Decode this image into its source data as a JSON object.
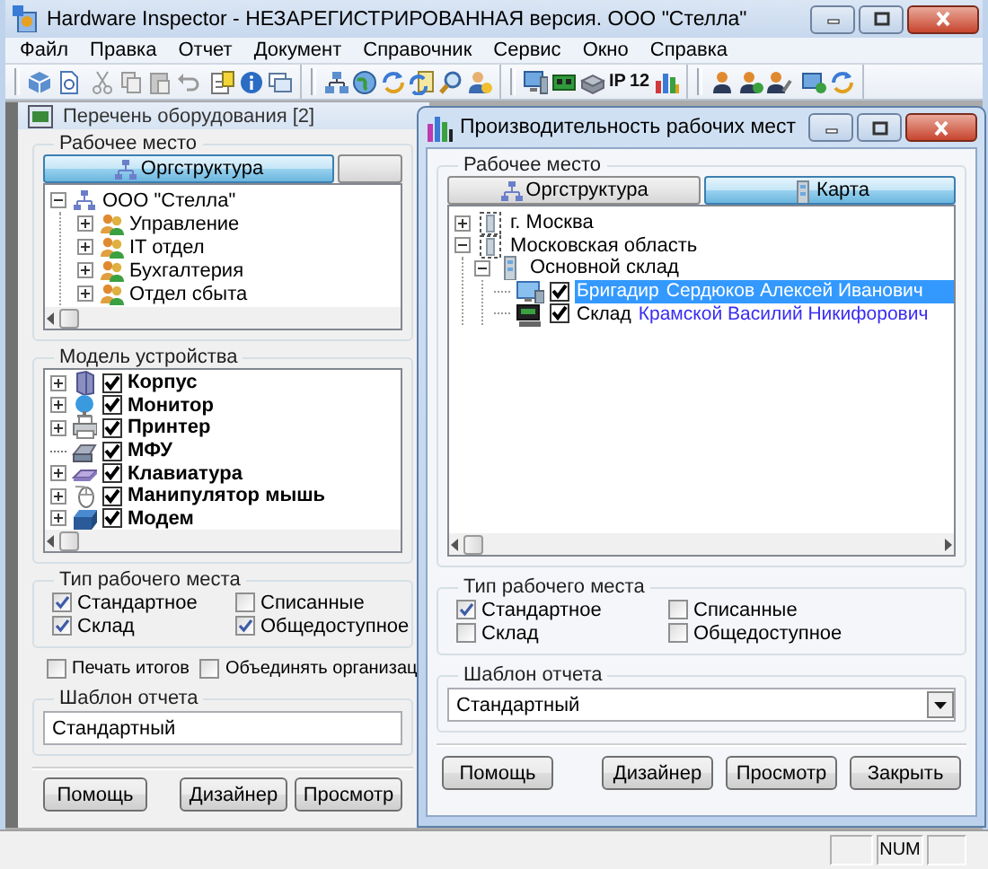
{
  "window": {
    "title": "Hardware Inspector - НЕЗАРЕГИСТРИРОВАННАЯ версия. ООО \"Стелла\""
  },
  "menu": [
    "Файл",
    "Правка",
    "Отчет",
    "Документ",
    "Справочник",
    "Сервис",
    "Окно",
    "Справка"
  ],
  "toolbar_labels": [
    "IP",
    "12"
  ],
  "equipment_window": {
    "title": "Перечень оборудования [2]",
    "workplace": {
      "legend": "Рабочее место",
      "tabs": [
        {
          "label": "Оргструктура",
          "selected": true
        },
        {
          "selected": false
        }
      ],
      "tree": [
        {
          "label": "ООО \"Стелла\"",
          "expanded": true,
          "children": [
            {
              "label": "Управление",
              "expanded": false
            },
            {
              "label": "IT отдел",
              "expanded": false
            },
            {
              "label": "Бухгалтерия",
              "expanded": false
            },
            {
              "label": "Отдел сбыта",
              "expanded": false
            }
          ]
        }
      ]
    },
    "devices": {
      "legend": "Модель устройства",
      "items": [
        {
          "label": "Корпус",
          "expandable": true,
          "checked": true
        },
        {
          "label": "Монитор",
          "expandable": true,
          "checked": true
        },
        {
          "label": "Принтер",
          "expandable": true,
          "checked": true
        },
        {
          "label": "МФУ",
          "expandable": false,
          "checked": true
        },
        {
          "label": "Клавиатура",
          "expandable": true,
          "checked": true
        },
        {
          "label": "Манипулятор мышь",
          "expandable": true,
          "checked": true
        },
        {
          "label": "Модем",
          "expandable": true,
          "checked": true
        }
      ]
    },
    "workplace_type": {
      "legend": "Тип рабочего места",
      "options": [
        {
          "label": "Стандартное",
          "checked": true
        },
        {
          "label": "Списанные",
          "checked": false
        },
        {
          "label": "Склад",
          "checked": true
        },
        {
          "label": "Общедоступное",
          "checked": true
        }
      ]
    },
    "options": [
      {
        "label": "Печать итогов",
        "checked": false
      },
      {
        "label": "Объединять организац",
        "checked": false
      }
    ],
    "report_template": {
      "legend": "Шаблон отчета",
      "value": "Стандартный"
    },
    "buttons": [
      "Помощь",
      "Дизайнер",
      "Просмотр"
    ]
  },
  "dialog": {
    "title": "Производительность рабочих мест",
    "workplace": {
      "legend": "Рабочее место",
      "tabs": [
        {
          "label": "Оргструктура",
          "selected": false
        },
        {
          "label": "Карта",
          "selected": true
        }
      ],
      "tree": [
        {
          "label": "г. Москва",
          "expanded": false
        },
        {
          "label": "Московская область",
          "expanded": true,
          "children": [
            {
              "label": "Основной склад",
              "expanded": true,
              "children": [
                {
                  "kind": "workstation",
                  "role": "Бригадир",
                  "person": "Сердюков Алексей Иванович",
                  "checked": true,
                  "selected": true
                },
                {
                  "kind": "workstation",
                  "role": "Склад",
                  "person": "Крамской Василий Никифорович",
                  "checked": true,
                  "selected": false
                }
              ]
            }
          ]
        }
      ]
    },
    "workplace_type": {
      "legend": "Тип рабочего места",
      "options": [
        {
          "label": "Стандартное",
          "checked": true
        },
        {
          "label": "Списанные",
          "checked": false
        },
        {
          "label": "Склад",
          "checked": false
        },
        {
          "label": "Общедоступное",
          "checked": false
        }
      ]
    },
    "report_template": {
      "legend": "Шаблон отчета",
      "value": "Стандартный"
    },
    "buttons": [
      "Помощь",
      "Дизайнер",
      "Просмотр",
      "Закрыть"
    ]
  },
  "status_bar": {
    "num": "NUM"
  }
}
